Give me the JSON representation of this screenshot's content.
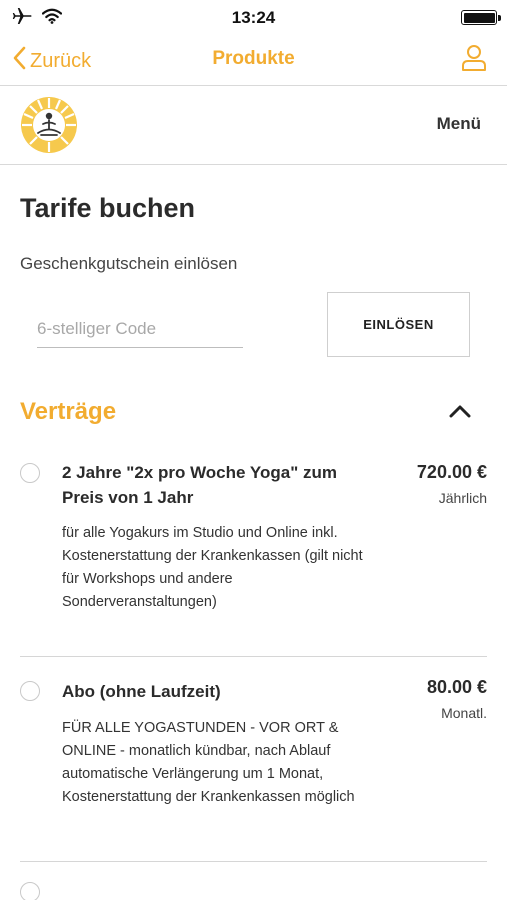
{
  "status_bar": {
    "time": "13:24",
    "icons": [
      "airplane-icon",
      "wifi-icon",
      "battery-icon"
    ]
  },
  "nav": {
    "back_label": "Zurück",
    "title": "Produkte",
    "accent_color": "#f2ac30"
  },
  "header": {
    "menu_label": "Menü"
  },
  "page": {
    "title": "Tarife buchen"
  },
  "voucher": {
    "label": "Geschenkgutschein einlösen",
    "input_placeholder": "6-stelliger Code",
    "input_value": "",
    "button_label": "EINLÖSEN"
  },
  "section": {
    "title": "Verträge",
    "expanded": true
  },
  "tariffs": [
    {
      "name": "2 Jahre \"2x pro Woche Yoga\" zum Preis von 1 Jahr",
      "price": "720.00 €",
      "period": "Jährlich",
      "description": "für alle Yogakurs im Studio und Online inkl. Kostenerstattung der Krankenkassen (gilt nicht für Workshops und andere Sonderveranstaltungen)",
      "selected": false
    },
    {
      "name": "Abo (ohne Laufzeit)",
      "price": "80.00 €",
      "period": "Monatl.",
      "description": "FÜR ALLE YOGASTUNDEN - VOR ORT & ONLINE - monatlich kündbar, nach Ablauf automatische Verlängerung um 1 Monat, Kostenerstattung der Krankenkassen möglich",
      "selected": false
    },
    {
      "selected": false
    }
  ]
}
